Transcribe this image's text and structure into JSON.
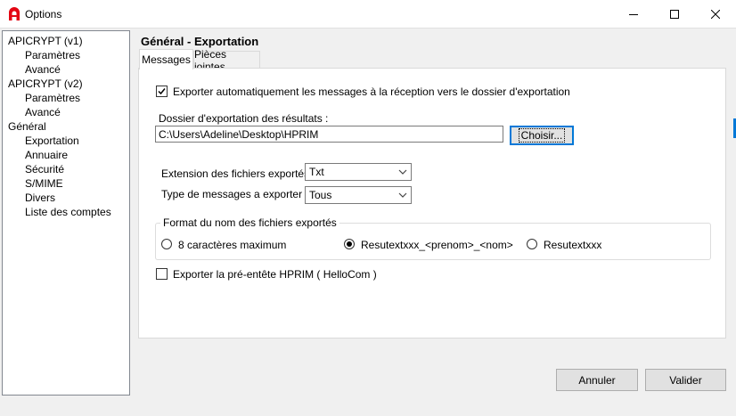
{
  "window": {
    "title": "Options",
    "app_icon": "apicrypt-logo-icon",
    "accent_color": "#e30613"
  },
  "sidebar": {
    "items": [
      {
        "label": "APICRYPT (v1)",
        "level": 0
      },
      {
        "label": "Paramètres",
        "level": 1
      },
      {
        "label": "Avancé",
        "level": 1
      },
      {
        "label": "APICRYPT (v2)",
        "level": 0
      },
      {
        "label": "Paramètres",
        "level": 1
      },
      {
        "label": "Avancé",
        "level": 1
      },
      {
        "label": "Général",
        "level": 0
      },
      {
        "label": "Exportation",
        "level": 1
      },
      {
        "label": "Annuaire",
        "level": 1
      },
      {
        "label": "Sécurité",
        "level": 1
      },
      {
        "label": "S/MIME",
        "level": 1
      },
      {
        "label": "Divers",
        "level": 1
      },
      {
        "label": "Liste des comptes",
        "level": 1
      }
    ]
  },
  "main": {
    "section_title": "Général - Exportation",
    "tabs": [
      {
        "label": "Messages",
        "active": true
      },
      {
        "label": "Pièces jointes",
        "active": false
      }
    ],
    "auto_export": {
      "label": "Exporter automatiquement les messages à la réception vers le dossier d'exportation",
      "checked": true
    },
    "folder": {
      "label": "Dossier d'exportation des résultats :",
      "value": "C:\\Users\\Adeline\\Desktop\\HPRIM",
      "choose_button": "Choisir..."
    },
    "extension": {
      "label": "Extension des fichiers exportés :",
      "selected": "Txt"
    },
    "message_type": {
      "label": "Type de messages a exporter :",
      "selected": "Tous"
    },
    "filename_format": {
      "legend": "Format du nom des fichiers exportés",
      "options": [
        {
          "label": "8 caractères maximum",
          "selected": false
        },
        {
          "label": "Resutextxxx_<prenom>_<nom>",
          "selected": true
        },
        {
          "label": "Resutextxxx",
          "selected": false
        }
      ]
    },
    "export_header": {
      "label": "Exporter la pré-entête HPRIM ( HelloCom )",
      "checked": false
    }
  },
  "footer": {
    "cancel_label": "Annuler",
    "ok_label": "Valider"
  }
}
